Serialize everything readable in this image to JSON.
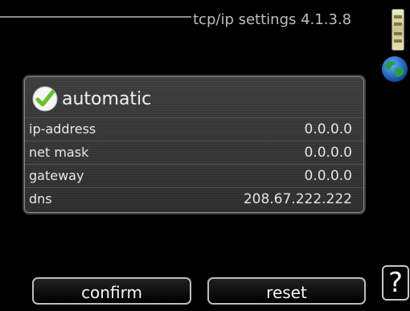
{
  "header": {
    "title": "tcp/ip settings 4.1.3.8"
  },
  "automatic": {
    "label": "automatic",
    "checked": true,
    "icon": "check-icon"
  },
  "fields": [
    {
      "label": "ip-address",
      "value": "0.0.0.0"
    },
    {
      "label": "net mask",
      "value": "0.0.0.0"
    },
    {
      "label": "gateway",
      "value": "0.0.0.0"
    },
    {
      "label": "dns",
      "value": "208.67.222.222"
    }
  ],
  "buttons": {
    "confirm": "confirm",
    "reset": "reset",
    "help": "?"
  },
  "icons": {
    "side_indicator": "scroll-indicator-icon",
    "globe": "globe-icon",
    "help": "help-icon"
  },
  "colors": {
    "background": "#000000",
    "panel": "#343434",
    "check": "#7ac943",
    "text": "#e8e8e8"
  }
}
